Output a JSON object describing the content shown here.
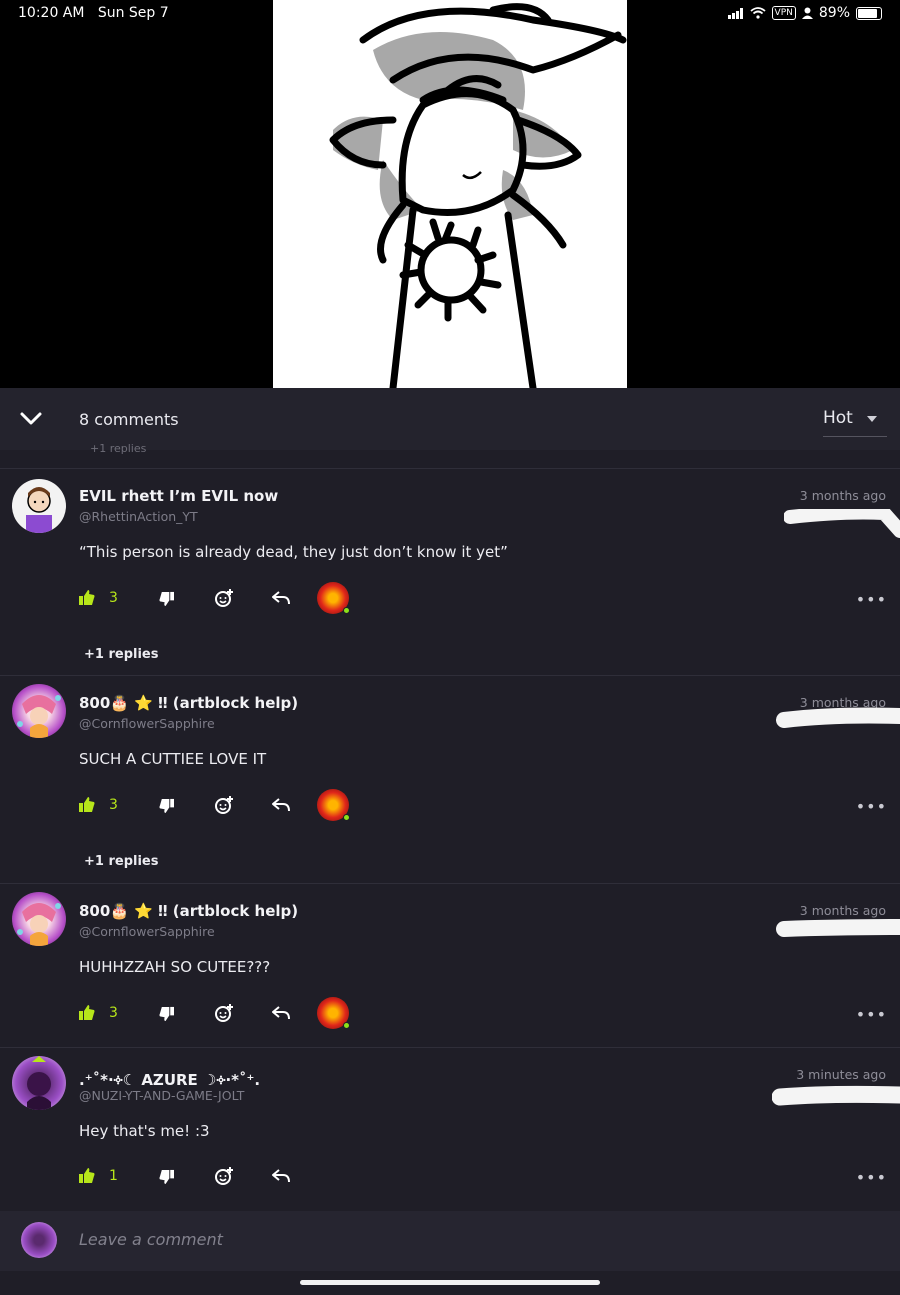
{
  "status_bar": {
    "time": "10:20 AM",
    "date": "Sun Sep 7",
    "vpn_label": "VPN",
    "battery_percent": "89%",
    "battery_level": 0.89
  },
  "comments_header": {
    "count_label": "8 comments",
    "sort_selected": "Hot",
    "faded_replies": "+1 replies"
  },
  "comments": [
    {
      "username": "EVIL rhett I’m EVIL now",
      "handle": "@RhettinAction_YT",
      "timestamp": "3 months ago",
      "text": "“This person is already dead, they just don’t know it yet”",
      "likes": "3",
      "replies": "+1 replies"
    },
    {
      "username": "800🎂 ⭐ ‼ (artblock help)",
      "handle": "@CornflowerSapphire",
      "timestamp": "3 months ago",
      "text": "SUCH A CUTTIEE LOVE IT",
      "likes": "3",
      "replies": "+1 replies"
    },
    {
      "username": "800🎂 ⭐ ‼ (artblock help)",
      "handle": "@CornflowerSapphire",
      "timestamp": "3 months ago",
      "text": "HUHHZZAH SO CUTEE???",
      "likes": "3"
    },
    {
      "username": ".⁺˚*·༓☾ AZURE ☽༓·*˚⁺.",
      "handle": "@NUZI-YT-AND-GAME-JOLT",
      "timestamp": "3 minutes ago",
      "text": "Hey that's me! :3",
      "likes": "1"
    }
  ],
  "composer": {
    "placeholder": "Leave a comment"
  },
  "colors": {
    "panel_bg": "#1f1e27",
    "like_accent": "#b7e61a"
  }
}
